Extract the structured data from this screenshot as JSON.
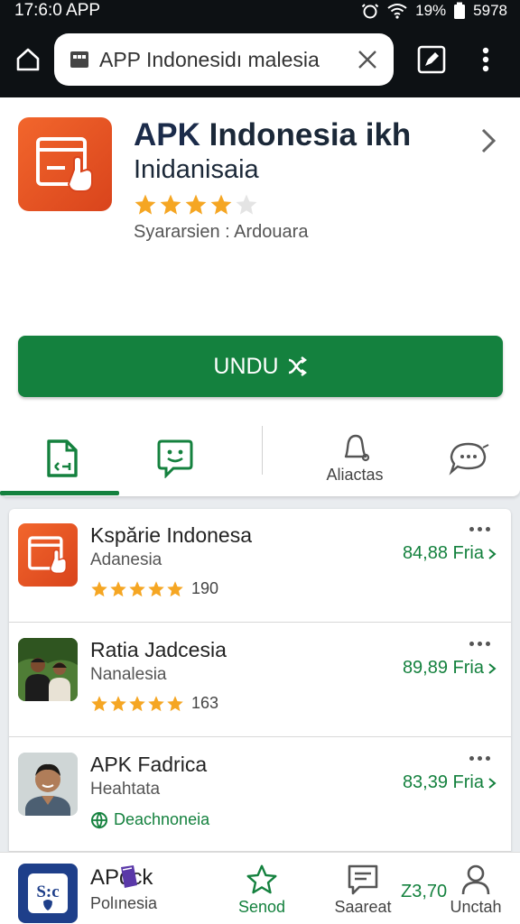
{
  "status_bar": {
    "time": "17:6:0 APP",
    "battery": "19%",
    "extra": "5978"
  },
  "browser": {
    "url": "APP Indonesidı malesia"
  },
  "app": {
    "title_part1": "APK",
    "title_part2": "Indonesia ikh",
    "subtitle": "Inidanisaia",
    "rating_stars": 4,
    "developer": "Syararsien : Ardouara",
    "download_label": "UNDU",
    "icon": "app-window-hand-icon",
    "accent_color": "#f2662c"
  },
  "tabs": [
    {
      "name": "file-icon",
      "label": ""
    },
    {
      "name": "smiley-chat-icon",
      "label": ""
    },
    {
      "name": "bell-icon",
      "label": "Aliactas"
    },
    {
      "name": "chat-bubble-icon",
      "label": ""
    }
  ],
  "list": [
    {
      "title": "Kspărie Indonesa",
      "subtitle": "Adanesia",
      "rating": 5,
      "count": "190",
      "price": "84,88 Fria",
      "icon": "app-window-hand-icon"
    },
    {
      "title": "Ratia Jadcesia",
      "subtitle": "Nanalesia",
      "rating": 5,
      "count": "163",
      "price": "89,89 Fria",
      "icon": "photo-two-people"
    },
    {
      "title": "APK Fadrica",
      "subtitle": "Heahtata",
      "badge": "Deachnoneia",
      "price": "83,39 Fria",
      "icon": "photo-man-smiling"
    }
  ],
  "bottom_nav": {
    "app_title": "APdck",
    "app_sub": "Polınesia",
    "items": [
      {
        "label": "Senod",
        "icon": "star-icon",
        "active": true
      },
      {
        "label": "Saareat",
        "icon": "message-icon",
        "active": false
      },
      {
        "label": "Unctah",
        "icon": "user-icon",
        "active": false
      }
    ],
    "price": "Z3,70"
  },
  "colors": {
    "primary_green": "#14813e",
    "star": "#f5a623",
    "dark_bar": "#0d1114"
  }
}
